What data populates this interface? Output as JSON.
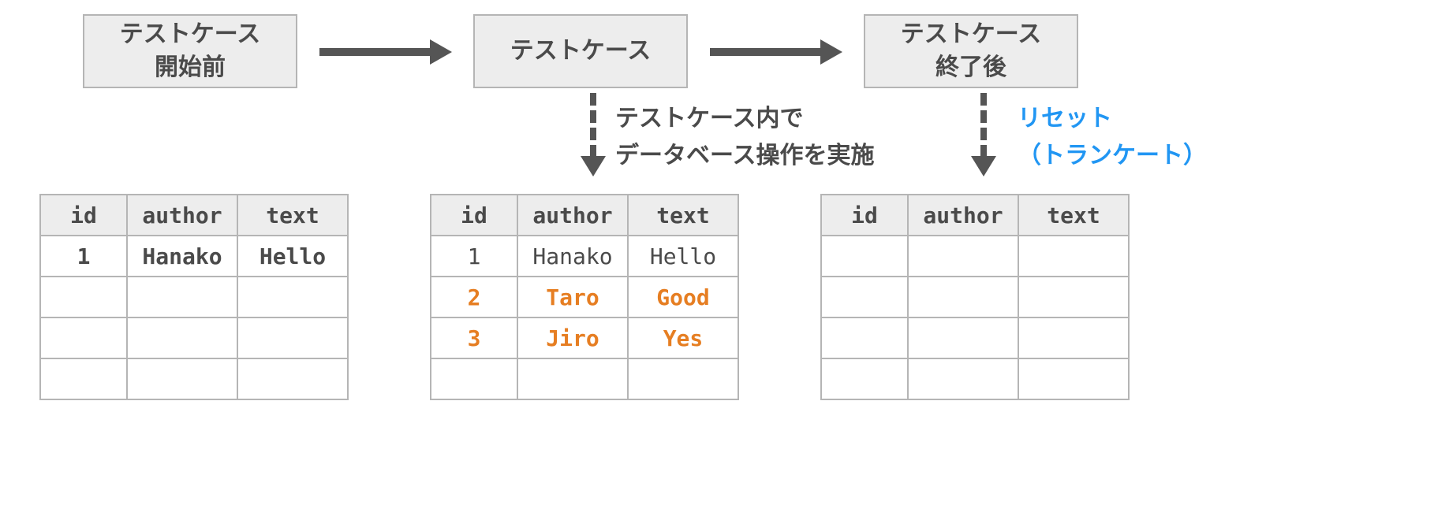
{
  "stages": {
    "before": {
      "line1": "テストケース",
      "line2": "開始前"
    },
    "during": {
      "line1": "テストケース"
    },
    "after": {
      "line1": "テストケース",
      "line2": "終了後"
    }
  },
  "annotations": {
    "middle": {
      "line1": "テストケース内で",
      "line2": "データベース操作を実施"
    },
    "right": {
      "line1": "リセット",
      "line2": "（トランケート）"
    }
  },
  "tables": {
    "headers": {
      "id": "id",
      "author": "author",
      "text": "text"
    },
    "before_rows": [
      {
        "id": "1",
        "author": "Hanako",
        "text": "Hello",
        "style": "bold"
      },
      {
        "id": "",
        "author": "",
        "text": ""
      },
      {
        "id": "",
        "author": "",
        "text": ""
      },
      {
        "id": "",
        "author": "",
        "text": ""
      }
    ],
    "during_rows": [
      {
        "id": "1",
        "author": "Hanako",
        "text": "Hello",
        "style": ""
      },
      {
        "id": "2",
        "author": "Taro",
        "text": "Good",
        "style": "orange"
      },
      {
        "id": "3",
        "author": "Jiro",
        "text": "Yes",
        "style": "orange"
      },
      {
        "id": "",
        "author": "",
        "text": "",
        "style": ""
      }
    ],
    "after_rows": [
      {
        "id": "",
        "author": "",
        "text": ""
      },
      {
        "id": "",
        "author": "",
        "text": ""
      },
      {
        "id": "",
        "author": "",
        "text": ""
      },
      {
        "id": "",
        "author": "",
        "text": ""
      }
    ]
  }
}
